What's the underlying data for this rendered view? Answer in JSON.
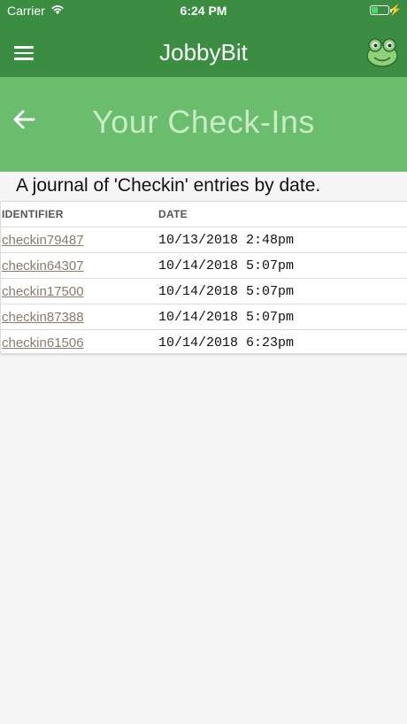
{
  "status_bar": {
    "carrier": "Carrier",
    "time": "6:24 PM"
  },
  "navbar": {
    "title": "JobbyBit",
    "menu_icon": "hamburger-menu-icon",
    "avatar_icon": "frog-icon"
  },
  "banner": {
    "title": "Your Check-Ins",
    "back_icon": "back-arrow-icon"
  },
  "subtitle": "A journal of 'Checkin' entries by date.",
  "table": {
    "headers": [
      "IDENTIFIER",
      "DATE"
    ],
    "rows": [
      {
        "id": "checkin79487",
        "date": "10/13/2018 2:48pm"
      },
      {
        "id": "checkin64307",
        "date": "10/14/2018 5:07pm"
      },
      {
        "id": "checkin17500",
        "date": "10/14/2018 5:07pm"
      },
      {
        "id": "checkin87388",
        "date": "10/14/2018 5:07pm"
      },
      {
        "id": "checkin61506",
        "date": "10/14/2018 6:23pm"
      }
    ]
  },
  "colors": {
    "nav_green": "#3a8d41",
    "banner_green": "#6abd6d",
    "link": "#8a7b6e"
  }
}
